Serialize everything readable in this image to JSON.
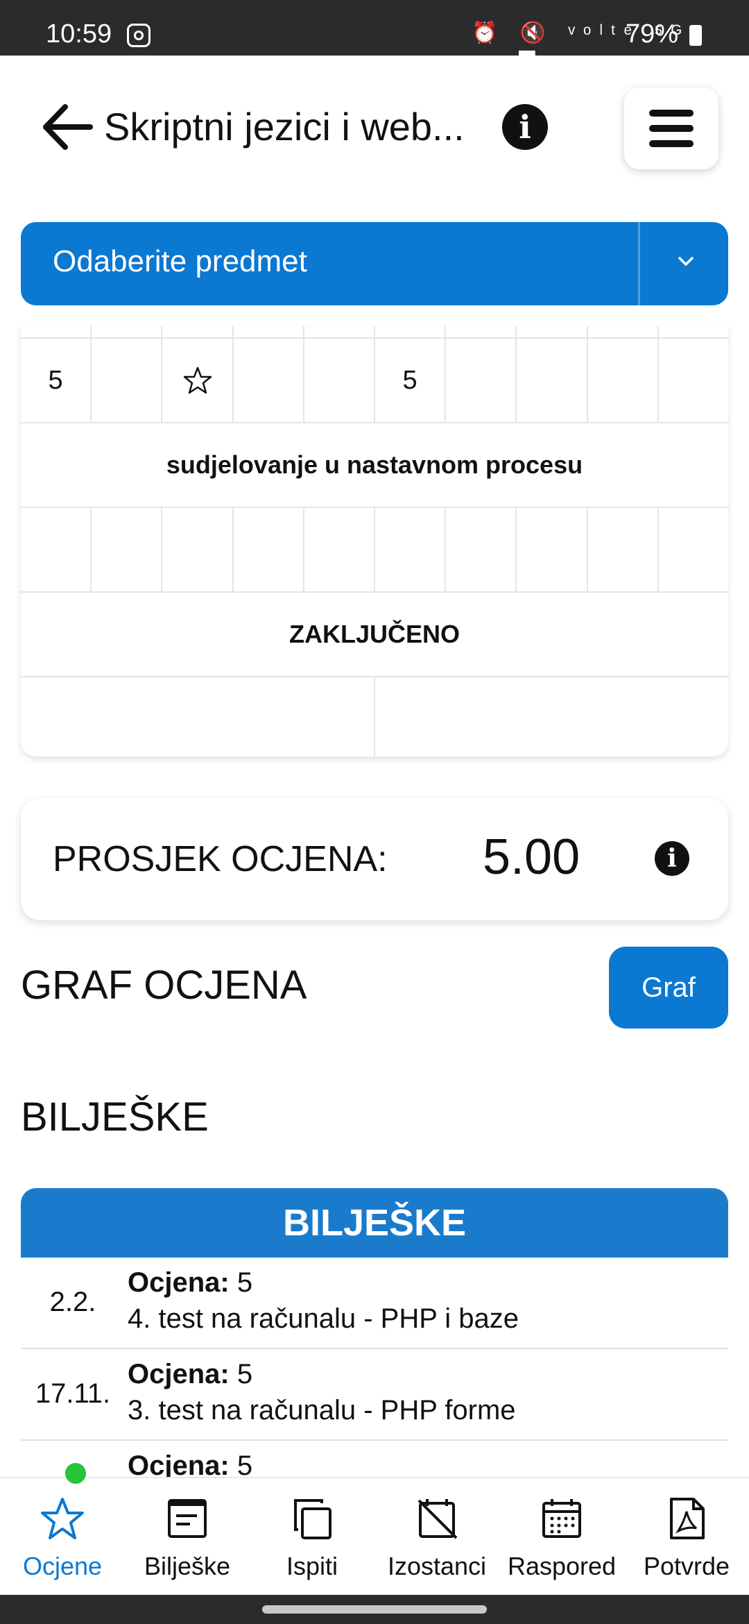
{
  "status_bar": {
    "time": "10:59",
    "battery": "79%",
    "icons": "⏰ 🔇 ᵛᵒˡᵗᵉ ⁵ᴳ ▂▄▆"
  },
  "header": {
    "title": "Skriptni jezici i web..."
  },
  "subject_select": {
    "label": "Odaberite predmet"
  },
  "grades_table": {
    "top_row": [
      "5",
      "",
      "star",
      "",
      "",
      "5",
      "",
      "",
      "",
      ""
    ],
    "section_1_title": "sudjelovanje u nastavnom procesu",
    "section_1_cells": [
      "",
      "",
      "",
      "",
      "",
      "",
      "",
      "",
      "",
      ""
    ],
    "section_2_title": "ZAKLJUČENO",
    "section_2_cells": [
      "",
      ""
    ]
  },
  "average": {
    "label": "PROSJEK OCJENA:",
    "value": "5.00"
  },
  "graph": {
    "heading": "GRAF OCJENA",
    "button": "Graf"
  },
  "notes": {
    "heading": "BILJEŠKE",
    "table_header": "BILJEŠKE",
    "rows": [
      {
        "date": "2.2.",
        "grade_label": "Ocjena:",
        "grade": "5",
        "desc": "4. test na računalu - PHP i baze"
      },
      {
        "date": "17.11.",
        "grade_label": "Ocjena:",
        "grade": "5",
        "desc": "3. test na računalu - PHP forme"
      },
      {
        "date": "",
        "grade_label": "Ocjena:",
        "grade": "5",
        "desc": ""
      }
    ]
  },
  "bottom_nav": [
    {
      "label": "Ocjene",
      "icon": "star-icon",
      "active": true
    },
    {
      "label": "Bilješke",
      "icon": "notes-icon"
    },
    {
      "label": "Ispiti",
      "icon": "copy-icon"
    },
    {
      "label": "Izostanci",
      "icon": "calendar-off-icon"
    },
    {
      "label": "Raspored",
      "icon": "calendar-icon"
    },
    {
      "label": "Potvrde",
      "icon": "pdf-icon"
    }
  ],
  "colors": {
    "accent": "#0b78d1",
    "status_bar": "#2b2b2d",
    "notification_dot": "#28c33a"
  }
}
